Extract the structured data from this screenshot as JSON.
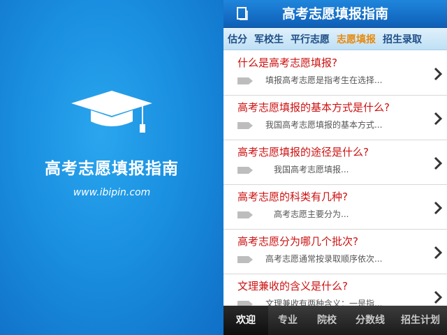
{
  "splash": {
    "title": "高考志愿填报指南",
    "url": "www.ibipin.com",
    "icon": "graduation-cap-icon"
  },
  "header": {
    "title": "高考志愿填报指南",
    "icon": "document-icon",
    "color": "#1a7bd5"
  },
  "tabs": [
    {
      "label": "估分",
      "active": false
    },
    {
      "label": "军校生",
      "active": false
    },
    {
      "label": "平行志愿",
      "active": false
    },
    {
      "label": "志愿填报",
      "active": true
    },
    {
      "label": "招生录取",
      "active": false
    }
  ],
  "items": [
    {
      "question": "什么是高考志愿填报?",
      "answer": "填报高考志愿是指考生在选择..."
    },
    {
      "question": "高考志愿填报的基本方式是什么?",
      "answer": "我国高考志愿填报的基本方式..."
    },
    {
      "question": "高考志愿填报的途径是什么?",
      "answer": "我国高考志愿填报..."
    },
    {
      "question": "高考志愿的科类有几种?",
      "answer": "高考志愿主要分为..."
    },
    {
      "question": "高考志愿分为哪几个批次?",
      "answer": "高考志愿通常按录取顺序依次..."
    },
    {
      "question": "文理兼收的含义是什么?",
      "answer": "文理兼收有两种含义：一是指..."
    }
  ],
  "bottom_nav": [
    {
      "label": "欢迎",
      "active": true
    },
    {
      "label": "专业",
      "active": false
    },
    {
      "label": "院校",
      "active": false
    },
    {
      "label": "分数线",
      "active": false
    },
    {
      "label": "招生计划",
      "active": false
    }
  ],
  "colors": {
    "accent_tab": "#e7890c",
    "question_text": "#cc1111",
    "splash_bg": "#1a8fe0"
  }
}
